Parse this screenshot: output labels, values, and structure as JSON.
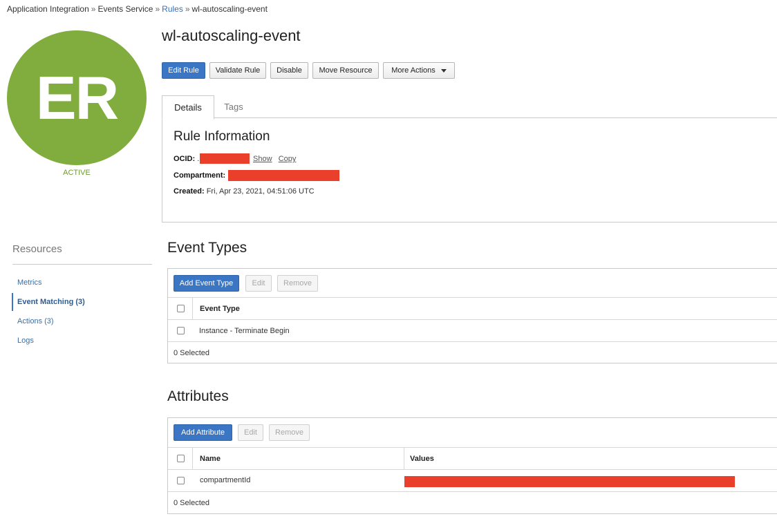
{
  "breadcrumb": {
    "item1": "Application Integration",
    "item2": "Events Service",
    "item3": "Rules",
    "item4": "wl-autoscaling-event",
    "separator": "»"
  },
  "avatar": {
    "initials": "ER",
    "status": "ACTIVE",
    "color": "#80ad3d"
  },
  "page": {
    "title": "wl-autoscaling-event"
  },
  "actions": {
    "edit_rule": "Edit Rule",
    "validate_rule": "Validate Rule",
    "disable": "Disable",
    "move_resource": "Move Resource",
    "more_actions": "More Actions"
  },
  "tabs": {
    "details": "Details",
    "tags": "Tags"
  },
  "rule_info": {
    "heading": "Rule Information",
    "ocid_label": "OCID:",
    "ocid_prefix": ".",
    "show_link": "Show",
    "copy_link": "Copy",
    "compartment_label": "Compartment:",
    "created_label": "Created:",
    "created_value": "Fri, Apr 23, 2021, 04:51:06 UTC"
  },
  "resources": {
    "title": "Resources",
    "items": [
      "Metrics",
      "Event Matching (3)",
      "Actions (3)",
      "Logs"
    ]
  },
  "event_types": {
    "heading": "Event Types",
    "add_button": "Add Event Type",
    "edit_button": "Edit",
    "remove_button": "Remove",
    "column_header": "Event Type",
    "rows": [
      "Instance - Terminate Begin"
    ],
    "footer": "0 Selected"
  },
  "attributes": {
    "heading": "Attributes",
    "add_button": "Add Attribute",
    "edit_button": "Edit",
    "remove_button": "Remove",
    "col_name": "Name",
    "col_values": "Values",
    "rows": [
      {
        "name": "compartmentId"
      }
    ],
    "footer": "0 Selected"
  },
  "colors": {
    "primary": "#3b76c4",
    "redaction": "#ea3f2b",
    "active_status": "#6b9b2d"
  }
}
